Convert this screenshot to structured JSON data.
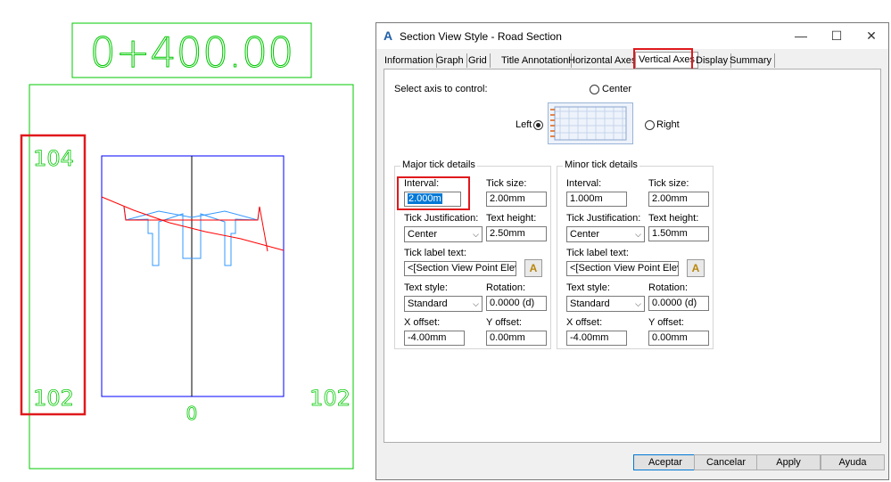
{
  "drawing": {
    "station_label": "0+400.00",
    "left_top_elev": "104",
    "left_bottom_elev": "102",
    "right_bottom_elev": "102",
    "center_offset": "0",
    "colors": {
      "frame": "#00c800",
      "grid": "#0000ff",
      "surface": "#ff0000",
      "template": "#3399ff",
      "highlight": "#e0191c"
    }
  },
  "dialog": {
    "title": "Section View Style - Road Section",
    "app_icon": "autocad-icon",
    "window_controls": {
      "minimize": "—",
      "maximize": "☐",
      "close": "✕"
    },
    "tabs": [
      "Information",
      "Graph",
      "Grid",
      "Title Annotation",
      "Horizontal Axes",
      "Vertical Axes",
      "Display",
      "Summary"
    ],
    "active_tab": "Vertical Axes",
    "select_axis_label": "Select axis to control:",
    "axis_options": {
      "center": "Center",
      "left": "Left",
      "right": "Right"
    },
    "selected_axis": "Left",
    "major": {
      "caption": "Major tick details",
      "interval_label": "Interval:",
      "interval_value": "2.000m",
      "tick_size_label": "Tick size:",
      "tick_size_value": "2.00mm",
      "justification_label": "Tick Justification:",
      "justification_value": "Center",
      "text_height_label": "Text height:",
      "text_height_value": "2.50mm",
      "label_text_label": "Tick label text:",
      "label_text_value": "<[Section View Point Elevatio",
      "text_style_label": "Text style:",
      "text_style_value": "Standard",
      "rotation_label": "Rotation:",
      "rotation_value": "0.0000 (d)",
      "x_offset_label": "X offset:",
      "x_offset_value": "-4.00mm",
      "y_offset_label": "Y offset:",
      "y_offset_value": "0.00mm"
    },
    "minor": {
      "caption": "Minor tick details",
      "interval_label": "Interval:",
      "interval_value": "1.000m",
      "tick_size_label": "Tick size:",
      "tick_size_value": "2.00mm",
      "justification_label": "Tick Justification:",
      "justification_value": "Center",
      "text_height_label": "Text height:",
      "text_height_value": "1.50mm",
      "label_text_label": "Tick label text:",
      "label_text_value": "<[Section View Point Elevatio",
      "text_style_label": "Text style:",
      "text_style_value": "Standard",
      "rotation_label": "Rotation:",
      "rotation_value": "0.0000 (d)",
      "x_offset_label": "X offset:",
      "x_offset_value": "-4.00mm",
      "y_offset_label": "Y offset:",
      "y_offset_value": "0.00mm"
    },
    "buttons": {
      "ok": "Aceptar",
      "cancel": "Cancelar",
      "apply": "Apply",
      "help": "Ayuda"
    }
  }
}
